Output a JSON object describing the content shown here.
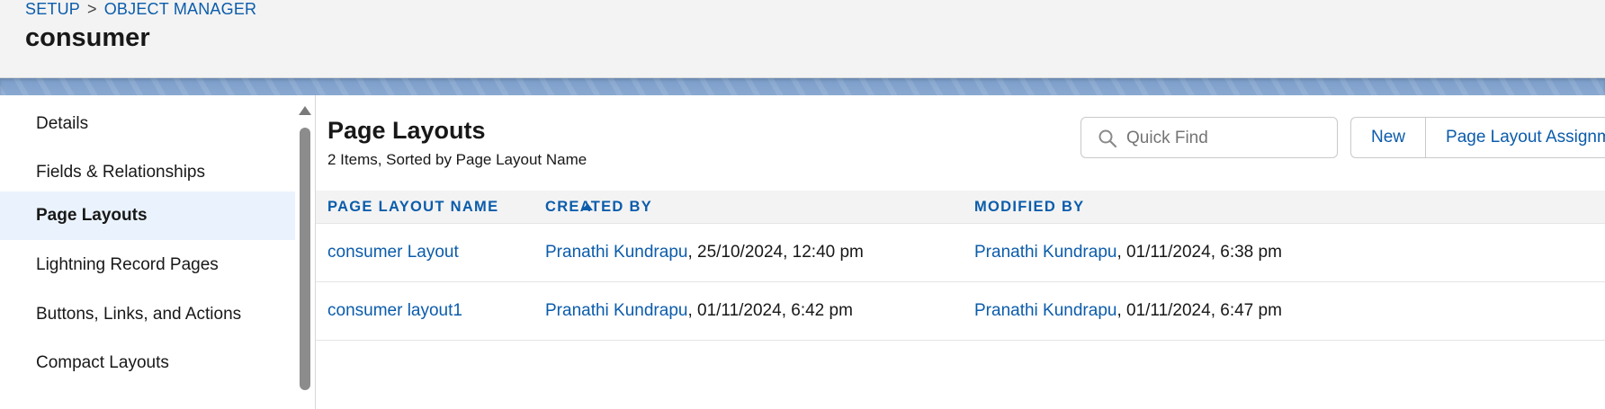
{
  "breadcrumb": {
    "setup": "SETUP",
    "separator": ">",
    "object_manager": "OBJECT MANAGER"
  },
  "object_title": "consumer",
  "sidebar": {
    "items": [
      {
        "label": "Details",
        "active": false
      },
      {
        "label": "Fields & Relationships",
        "active": false
      },
      {
        "label": "Page Layouts",
        "active": true
      },
      {
        "label": "Lightning Record Pages",
        "active": false
      },
      {
        "label": "Buttons, Links, and Actions",
        "active": false
      },
      {
        "label": "Compact Layouts",
        "active": false
      }
    ]
  },
  "main": {
    "title": "Page Layouts",
    "subtitle": "2 Items, Sorted by Page Layout Name",
    "search": {
      "placeholder": "Quick Find",
      "value": ""
    },
    "buttons": {
      "new": "New",
      "assignment": "Page Layout Assignment"
    },
    "columns": {
      "name": "PAGE LAYOUT NAME",
      "created": "CREATED BY",
      "modified": "MODIFIED BY"
    },
    "rows": [
      {
        "name": "consumer Layout",
        "created_user": "Pranathi Kundrapu",
        "created_date": ", 25/10/2024, 12:40 pm",
        "modified_user": "Pranathi Kundrapu",
        "modified_date": ", 01/11/2024, 6:38 pm"
      },
      {
        "name": "consumer layout1",
        "created_user": "Pranathi Kundrapu",
        "created_date": ", 01/11/2024, 6:42 pm",
        "modified_user": "Pranathi Kundrapu",
        "modified_date": ", 01/11/2024, 6:47 pm"
      }
    ]
  },
  "colors": {
    "link": "#0b5cab",
    "header_bg": "#f3f3f3",
    "active_item_bg": "#eaf3fd",
    "band": "#7b9dc9"
  }
}
